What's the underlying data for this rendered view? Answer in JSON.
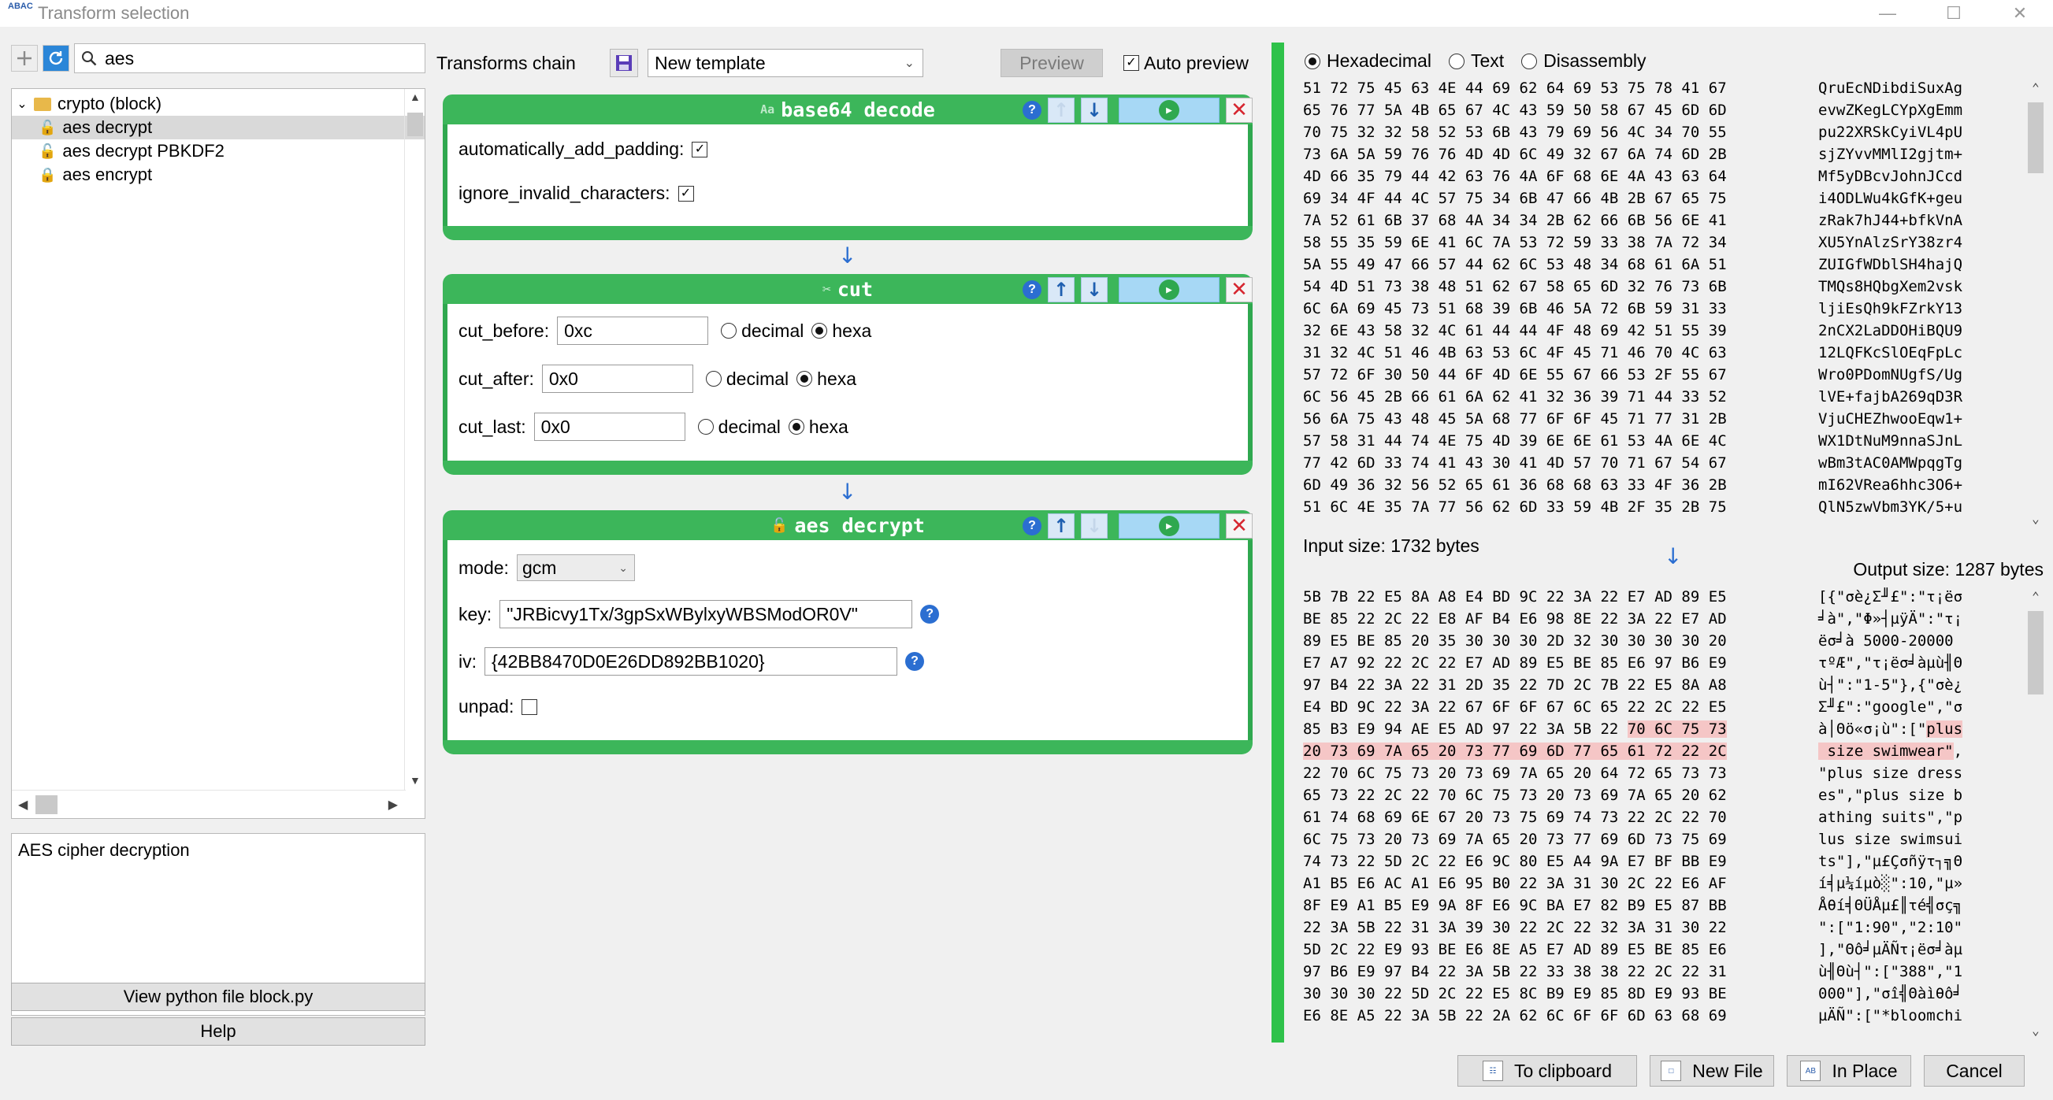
{
  "window": {
    "title": "Transform selection",
    "app_icon": "ABAC"
  },
  "search": {
    "value": "aes"
  },
  "tree": {
    "root": "crypto (block)",
    "items": [
      "aes decrypt",
      "aes decrypt PBKDF2",
      "aes encrypt"
    ]
  },
  "description": "AES cipher decryption",
  "buttons": {
    "view_python": "View python file block.py",
    "help": "Help",
    "to_clipboard": "To clipboard",
    "new_file": "New File",
    "in_place": "In Place",
    "cancel": "Cancel",
    "preview": "Preview",
    "auto_preview": "Auto preview"
  },
  "chain": {
    "label": "Transforms chain",
    "template": "New template",
    "blocks": [
      {
        "title": "base64 decode",
        "params": [
          {
            "label": "automatically_add_padding:",
            "checked": true
          },
          {
            "label": "ignore_invalid_characters:",
            "checked": true
          }
        ]
      },
      {
        "title": "cut",
        "params": [
          {
            "label": "cut_before:",
            "value": "0xc"
          },
          {
            "label": "cut_after:",
            "value": "0x0"
          },
          {
            "label": "cut_last:",
            "value": "0x0"
          }
        ],
        "radio_decimal": "decimal",
        "radio_hexa": "hexa"
      },
      {
        "title": "aes decrypt",
        "mode_label": "mode:",
        "mode": "gcm",
        "key_label": "key:",
        "key": "\"JRBicvy1Tx/3gpSxWBylxyWBSModOR0V\"",
        "iv_label": "iv:",
        "iv": "{42BB8470D0E26DD892BB1020}",
        "unpad_label": "unpad:",
        "unpad": false
      }
    ]
  },
  "view_modes": [
    "Hexadecimal",
    "Text",
    "Disassembly"
  ],
  "input": {
    "size_label": "Input size: 1732 bytes",
    "hex": [
      "51 72 75 45 63 4E 44 69 62 64 69 53 75 78 41 67",
      "65 76 77 5A 4B 65 67 4C 43 59 50 58 67 45 6D 6D",
      "70 75 32 32 58 52 53 6B 43 79 69 56 4C 34 70 55",
      "73 6A 5A 59 76 76 4D 4D 6C 49 32 67 6A 74 6D 2B",
      "4D 66 35 79 44 42 63 76 4A 6F 68 6E 4A 43 63 64",
      "69 34 4F 44 4C 57 75 34 6B 47 66 4B 2B 67 65 75",
      "7A 52 61 6B 37 68 4A 34 34 2B 62 66 6B 56 6E 41",
      "58 55 35 59 6E 41 6C 7A 53 72 59 33 38 7A 72 34",
      "5A 55 49 47 66 57 44 62 6C 53 48 34 68 61 6A 51",
      "54 4D 51 73 38 48 51 62 67 58 65 6D 32 76 73 6B",
      "6C 6A 69 45 73 51 68 39 6B 46 5A 72 6B 59 31 33",
      "32 6E 43 58 32 4C 61 44 44 4F 48 69 42 51 55 39",
      "31 32 4C 51 46 4B 63 53 6C 4F 45 71 46 70 4C 63",
      "57 72 6F 30 50 44 6F 4D 6E 55 67 66 53 2F 55 67",
      "6C 56 45 2B 66 61 6A 62 41 32 36 39 71 44 33 52",
      "56 6A 75 43 48 45 5A 68 77 6F 6F 45 71 77 31 2B",
      "57 58 31 44 74 4E 75 4D 39 6E 6E 61 53 4A 6E 4C",
      "77 42 6D 33 74 41 43 30 41 4D 57 70 71 67 54 67",
      "6D 49 36 32 56 52 65 61 36 68 68 63 33 4F 36 2B",
      "51 6C 4E 35 7A 77 56 62 6D 33 59 4B 2F 35 2B 75"
    ],
    "text": [
      "QruEcNDibdiSuxAg",
      "evwZKegLCYpXgEmm",
      "pu22XRSkCyiVL4pU",
      "sjZYvvMMlI2gjtm+",
      "Mf5yDBcvJohnJCcd",
      "i4ODLWu4kGfK+geu",
      "zRak7hJ44+bfkVnA",
      "XU5YnAlzSrY38zr4",
      "ZUIGfWDblSH4hajQ",
      "TMQs8HQbgXem2vsk",
      "ljiEsQh9kFZrkY13",
      "2nCX2LaDDOHiBQU9",
      "12LQFKcSlOEqFpLc",
      "Wro0PDomNUgfS/Ug",
      "lVE+fajbA269qD3R",
      "VjuCHEZhwooEqw1+",
      "WX1DtNuM9nnaSJnL",
      "wBm3tAC0AMWpqgTg",
      "mI62VRea6hhc3O6+",
      "QlN5zwVbm3YK/5+u"
    ]
  },
  "output": {
    "size_label": "Output size: 1287 bytes",
    "hex": [
      "5B 7B 22 E5 8A A8 E4 BD 9C 22 3A 22 E7 AD 89 E5",
      "BE 85 22 2C 22 E8 AF B4 E6 98 8E 22 3A 22 E7 AD",
      "89 E5 BE 85 20 35 30 30 30 2D 32 30 30 30 30 20",
      "E7 A7 92 22 2C 22 E7 AD 89 E5 BE 85 E6 97 B6 E9",
      "97 B4 22 3A 22 31 2D 35 22 7D 2C 7B 22 E5 8A A8",
      "E4 BD 9C 22 3A 22 67 6F 6F 67 6C 65 22 2C 22 E5",
      "85 B3 E9 94 AE E5 AD 97 22 3A 5B 22 70 6C 75 73",
      "20 73 69 7A 65 20 73 77 69 6D 77 65 61 72 22 2C",
      "22 70 6C 75 73 20 73 69 7A 65 20 64 72 65 73 73",
      "65 73 22 2C 22 70 6C 75 73 20 73 69 7A 65 20 62",
      "61 74 68 69 6E 67 20 73 75 69 74 73 22 2C 22 70",
      "6C 75 73 20 73 69 7A 65 20 73 77 69 6D 73 75 69",
      "74 73 22 5D 2C 22 E6 9C 80 E5 A4 9A E7 BF BB E9",
      "A1 B5 E6 AC A1 E6 95 B0 22 3A 31 30 2C 22 E6 AF",
      "8F E9 A1 B5 E9 9A 8F E6 9C BA E7 82 B9 E5 87 BB",
      "22 3A 5B 22 31 3A 39 30 22 2C 22 32 3A 31 30 22",
      "5D 2C 22 E9 93 BE E6 8E A5 E7 AD 89 E5 BE 85 E6",
      "97 B6 E9 97 B4 22 3A 5B 22 33 38 38 22 2C 22 31",
      "30 30 30 22 5D 2C 22 E5 8C B9 E9 85 8D E9 93 BE",
      "E6 8E A5 22 3A 5B 22 2A 62 6C 6F 6F 6D 63 68 69"
    ],
    "text": [
      "[{\"σè¿Σ╜£\":\"τ¡ëσ",
      "╛à\",\"Φ»┤µÿÄ\":\"τ¡",
      "ëσ╛à 5000-20000 ",
      "τºÆ\",\"τ¡ëσ╛àµù╢Θ",
      "ù┤\":\"1-5\"},{\"σè¿",
      "Σ╜£\":\"google\",\"σ",
      "à│Θö«σ¡ù\":[\"plus",
      " size swimwear\",",
      "\"plus size dress",
      "es\",\"plus size b",
      "athing suits\",\"p",
      "lus size swimsui",
      "ts\"],\"µ£Çσñÿτ┐╗Θ",
      "í╡µ¼íµò░\":10,\"µ»",
      "Åθí╡ΘÜÅµ£║τé╣σç╗",
      "\":[\"1:90\",\"2:10\"",
      "],\"Θô╛µÄÑτ¡ëσ╛àµ",
      "ù╢Θù┤\":[\"388\",\"1",
      "000\"],\"σî╣Θàìθô╛",
      "µÄÑ\":[\"*bloomchi"
    ]
  }
}
